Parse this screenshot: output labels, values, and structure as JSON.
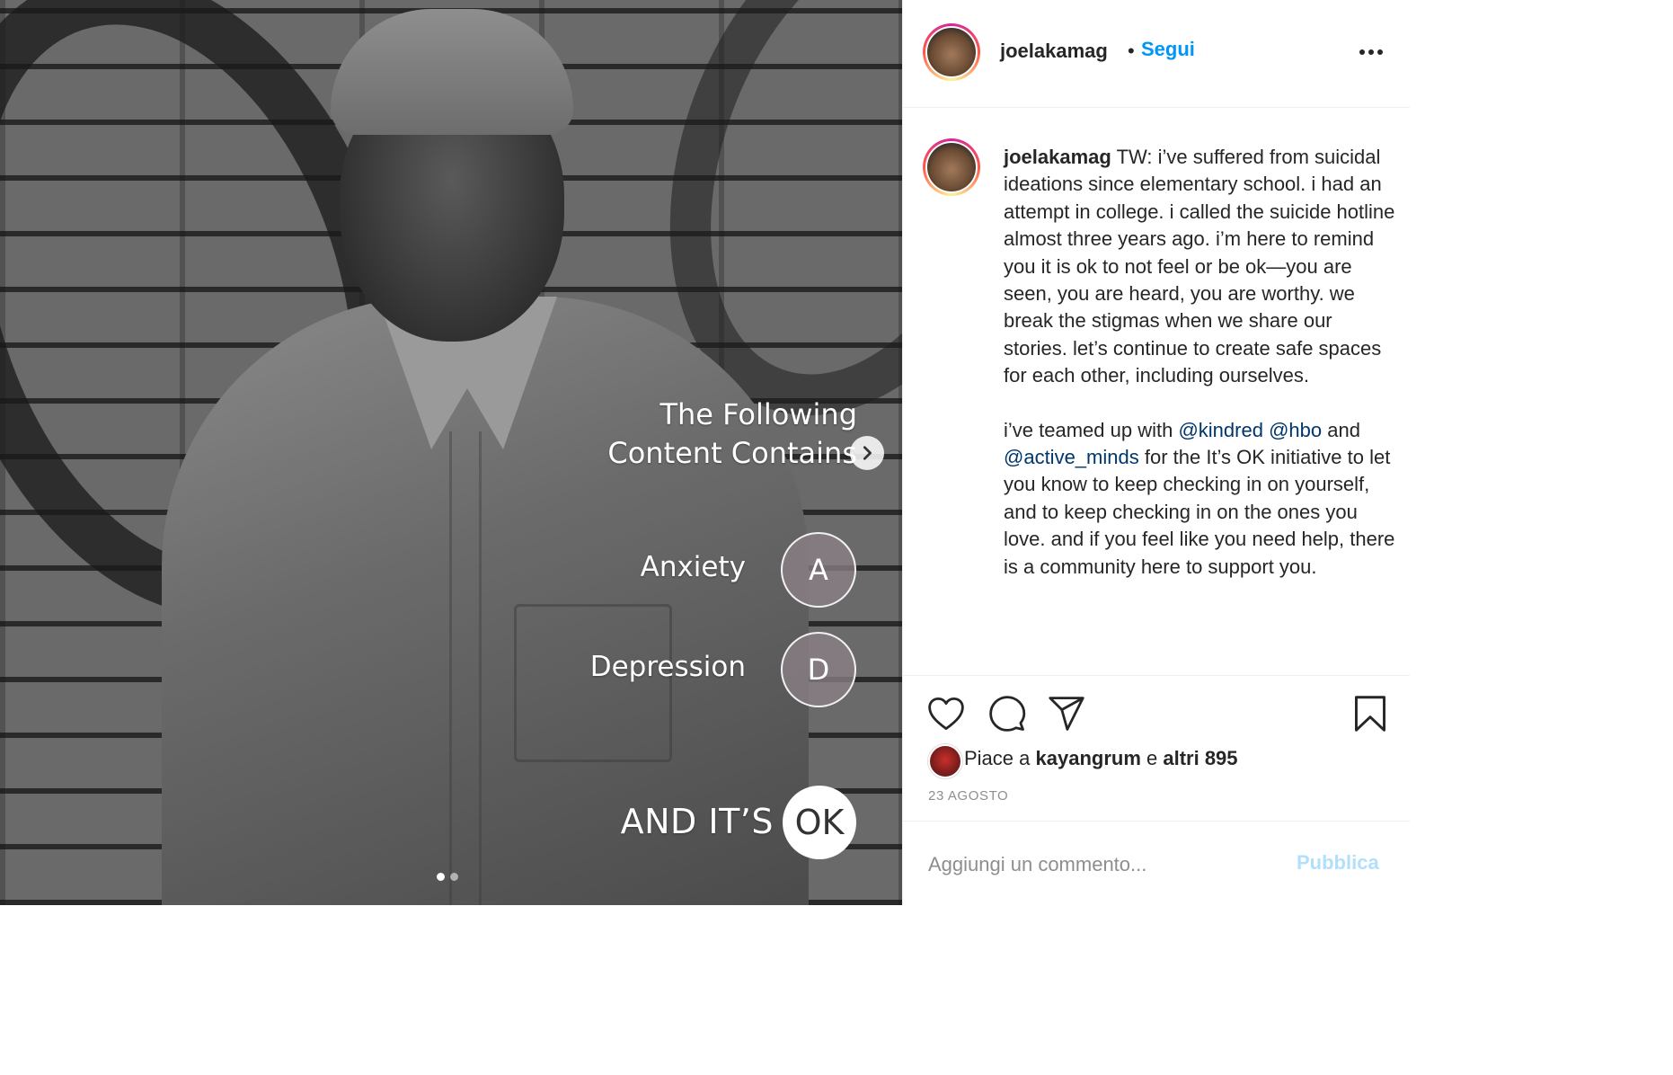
{
  "post_image": {
    "overlay": {
      "heading_line1": "The Following",
      "heading_line2": "Content Contains",
      "items": [
        {
          "label": "Anxiety",
          "badge": "A"
        },
        {
          "label": "Depression",
          "badge": "D"
        }
      ],
      "closing_text": "AND IT’S",
      "closing_badge": "OK"
    },
    "carousel": {
      "total": 2,
      "active": 1
    }
  },
  "header": {
    "username": "joelakamag",
    "separator": "•",
    "follow_label": "Segui"
  },
  "caption": {
    "username": "joelakamag",
    "paragraph1": "TW: i’ve suffered from suicidal ideations since elementary school. i had an attempt in college. i called the suicide hotline almost three years ago. i’m here to remind you it is ok to not feel or be ok—you are seen, you are heard, you are worthy. we break the stigmas when we share our stories. let’s continue to create safe spaces for each other, including ourselves.",
    "paragraph2": {
      "t1": "i’ve teamed up with ",
      "m1": "@kindred",
      "t2": " ",
      "m2": "@hbo",
      "t3": " and ",
      "m3": "@active_minds",
      "t4": " for the It’s OK initiative to let you know to keep checking in on yourself, and to keep checking in on the ones you love. and if you feel like you need help, there is a community here to support you."
    }
  },
  "actions": {
    "icons": [
      "heart-icon",
      "comment-icon",
      "share-icon",
      "bookmark-icon"
    ]
  },
  "likes": {
    "prefix": "Piace a ",
    "user": "kayangrum",
    "middle": " e ",
    "others": "altri 895"
  },
  "date": "23 AGOSTO",
  "comment": {
    "placeholder": "Aggiungi un commento...",
    "publish_label": "Pubblica"
  },
  "colors": {
    "link": "#0095f6",
    "mention": "#00376b",
    "publish_disabled": "#b2dffc",
    "text": "#262626",
    "muted": "#8e8e8e"
  }
}
